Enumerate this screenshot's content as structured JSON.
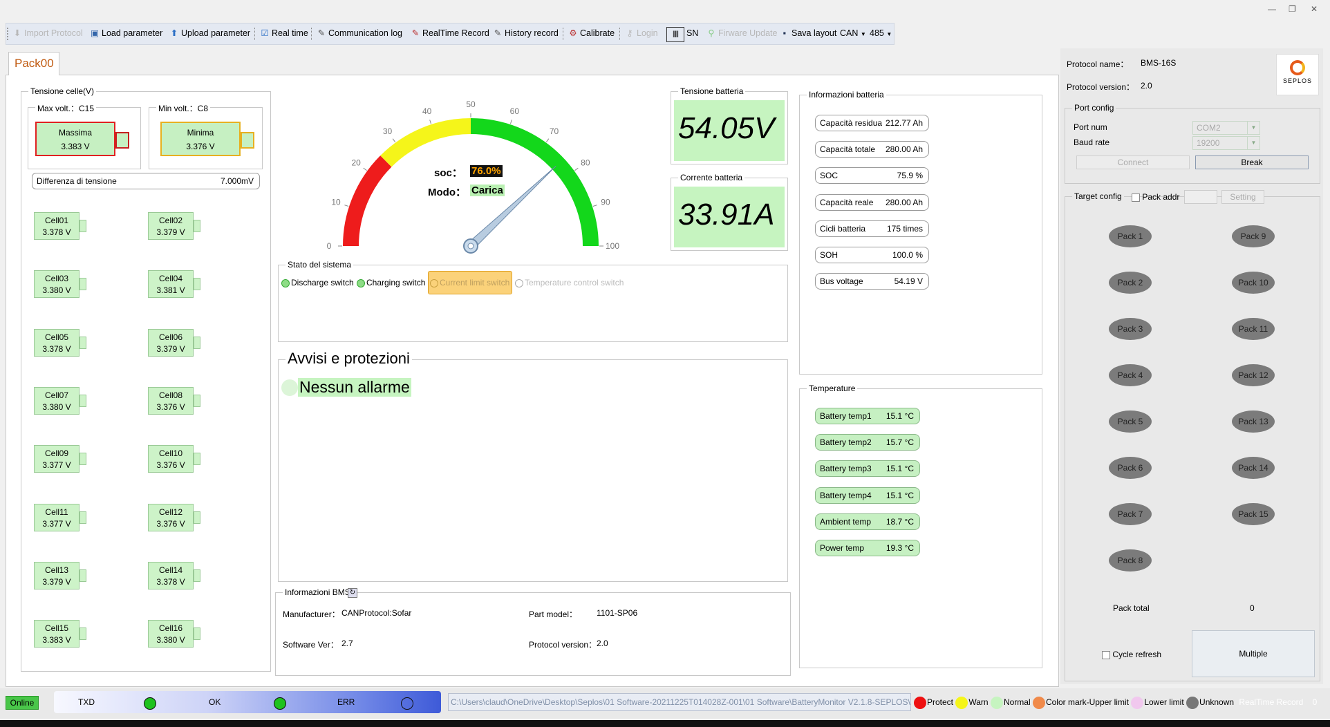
{
  "window": {
    "minimize": "—",
    "restore": "❐",
    "close": "✕"
  },
  "toolbar": {
    "import_protocol": "Import Protocol",
    "load_parameter": "Load parameter",
    "upload_parameter": "Upload parameter",
    "real_time": "Real time",
    "communication_log": "Communication log",
    "realtime_record": "RealTime Record",
    "history_record": "History record",
    "calibrate": "Calibrate",
    "login": "Login",
    "sn": "SN",
    "firmware_update": "Firware Update",
    "save_layout": "Sava layout",
    "can": "CAN",
    "baud485": "485"
  },
  "tab": {
    "label": "Pack00"
  },
  "cells_group": {
    "title": "Tensione celle(V)",
    "max_title": "Max volt.：C15",
    "max_label": "Massima",
    "max_value": "3.383 V",
    "min_title": "Min volt.：C8",
    "min_label": "Minima",
    "min_value": "3.376 V",
    "diff_label": "Differenza di tensione",
    "diff_value": "7.000mV",
    "cells": [
      {
        "name": "Cell01",
        "value": "3.378 V"
      },
      {
        "name": "Cell02",
        "value": "3.379 V"
      },
      {
        "name": "Cell03",
        "value": "3.380 V"
      },
      {
        "name": "Cell04",
        "value": "3.381 V"
      },
      {
        "name": "Cell05",
        "value": "3.378 V"
      },
      {
        "name": "Cell06",
        "value": "3.379 V"
      },
      {
        "name": "Cell07",
        "value": "3.380 V"
      },
      {
        "name": "Cell08",
        "value": "3.376 V"
      },
      {
        "name": "Cell09",
        "value": "3.377 V"
      },
      {
        "name": "Cell10",
        "value": "3.376 V"
      },
      {
        "name": "Cell11",
        "value": "3.377 V"
      },
      {
        "name": "Cell12",
        "value": "3.376 V"
      },
      {
        "name": "Cell13",
        "value": "3.379 V"
      },
      {
        "name": "Cell14",
        "value": "3.378 V"
      },
      {
        "name": "Cell15",
        "value": "3.383 V"
      },
      {
        "name": "Cell16",
        "value": "3.380 V"
      }
    ]
  },
  "gauge": {
    "soc_label": "soc：",
    "soc_value": "76.0%",
    "soc_fraction": 0.76,
    "mode_label": "Modo：",
    "mode_value": "Carica",
    "ticks": [
      "0",
      "10",
      "20",
      "30",
      "40",
      "50",
      "60",
      "70",
      "80",
      "90",
      "100"
    ],
    "colors": {
      "red": "#ee1c1c",
      "yellow": "#f5f51a",
      "green": "#13d71b"
    }
  },
  "battery_voltage": {
    "title": "Tensione batteria",
    "value": "54.05V"
  },
  "battery_current": {
    "title": "Corrente batteria",
    "value": "33.91A"
  },
  "system_state": {
    "title": "Stato del sistema",
    "discharge": "Discharge switch",
    "charging": "Charging switch",
    "current_limit": "Current limit switch",
    "temp_control": "Temperature control switch"
  },
  "alarms": {
    "title": "Avvisi e protezioni",
    "message": "Nessun allarme"
  },
  "bms_info": {
    "title": "Informazioni BMS",
    "manufacturer_label": "Manufacturer：",
    "manufacturer_value": "CANProtocol:Sofar",
    "part_label": "Part model：",
    "part_value": "1101-SP06",
    "software_label": "Software Ver：",
    "software_value": "2.7",
    "protocol_label": "Protocol version：",
    "protocol_value": "2.0"
  },
  "battery_info": {
    "title": "Informazioni batteria",
    "rows": [
      {
        "label": "Capacità residua",
        "value": "212.77 Ah"
      },
      {
        "label": "Capacità totale",
        "value": "280.00 Ah"
      },
      {
        "label": "SOC",
        "value": "75.9 %"
      },
      {
        "label": "Capacità reale",
        "value": "280.00 Ah"
      },
      {
        "label": "Cicli batteria",
        "value": "175 times"
      },
      {
        "label": "SOH",
        "value": "100.0 %"
      },
      {
        "label": "Bus voltage",
        "value": "54.19 V"
      }
    ]
  },
  "temperatures": {
    "title": "Temperature",
    "rows": [
      {
        "label": "Battery temp1",
        "value": "15.1 °C"
      },
      {
        "label": "Battery temp2",
        "value": "15.7 °C"
      },
      {
        "label": "Battery temp3",
        "value": "15.1 °C"
      },
      {
        "label": "Battery temp4",
        "value": "15.1 °C"
      },
      {
        "label": "Ambient temp",
        "value": "18.7 °C"
      },
      {
        "label": "Power temp",
        "value": "19.3 °C"
      }
    ]
  },
  "right_panel": {
    "protocol_name_label": "Protocol name：",
    "protocol_name_value": "BMS-16S",
    "protocol_version_label": "Protocol version：",
    "protocol_version_value": "2.0",
    "logo_text": "SEPLOS",
    "port_config_title": "Port config",
    "port_num_label": "Port num",
    "port_num_value": "COM2",
    "baud_label": "Baud rate",
    "baud_value": "19200",
    "connect": "Connect",
    "break": "Break",
    "target_config_title": "Target config",
    "pack_addr": "Pack addr",
    "setting": "Setting",
    "packs_left": [
      "Pack 1",
      "Pack 2",
      "Pack 3",
      "Pack 4",
      "Pack 5",
      "Pack 6",
      "Pack 7",
      "Pack 8"
    ],
    "packs_right": [
      "Pack 9",
      "Pack 10",
      "Pack 11",
      "Pack 12",
      "Pack 13",
      "Pack 14",
      "Pack 15"
    ],
    "pack_total_label": "Pack total",
    "pack_total_value": "0",
    "cycle_refresh": "Cycle refresh",
    "multiple": "Multiple"
  },
  "status_bar": {
    "online": "Online",
    "txd": "TXD",
    "ok": "OK",
    "err": "ERR",
    "path": "C:\\Users\\claud\\OneDrive\\Desktop\\Seplos\\01 Software-20211225T014028Z-001\\01 Software\\BatteryMonitor V2.1.8-SEPLOS\\",
    "legend": {
      "protect": "Protect",
      "warn": "Warn",
      "normal": "Normal",
      "upper": "Color mark-Upper limit",
      "lower": "Lower limit",
      "unknown": "Unknown"
    },
    "realtime_record": "RealTime Record",
    "record_count": "0"
  }
}
